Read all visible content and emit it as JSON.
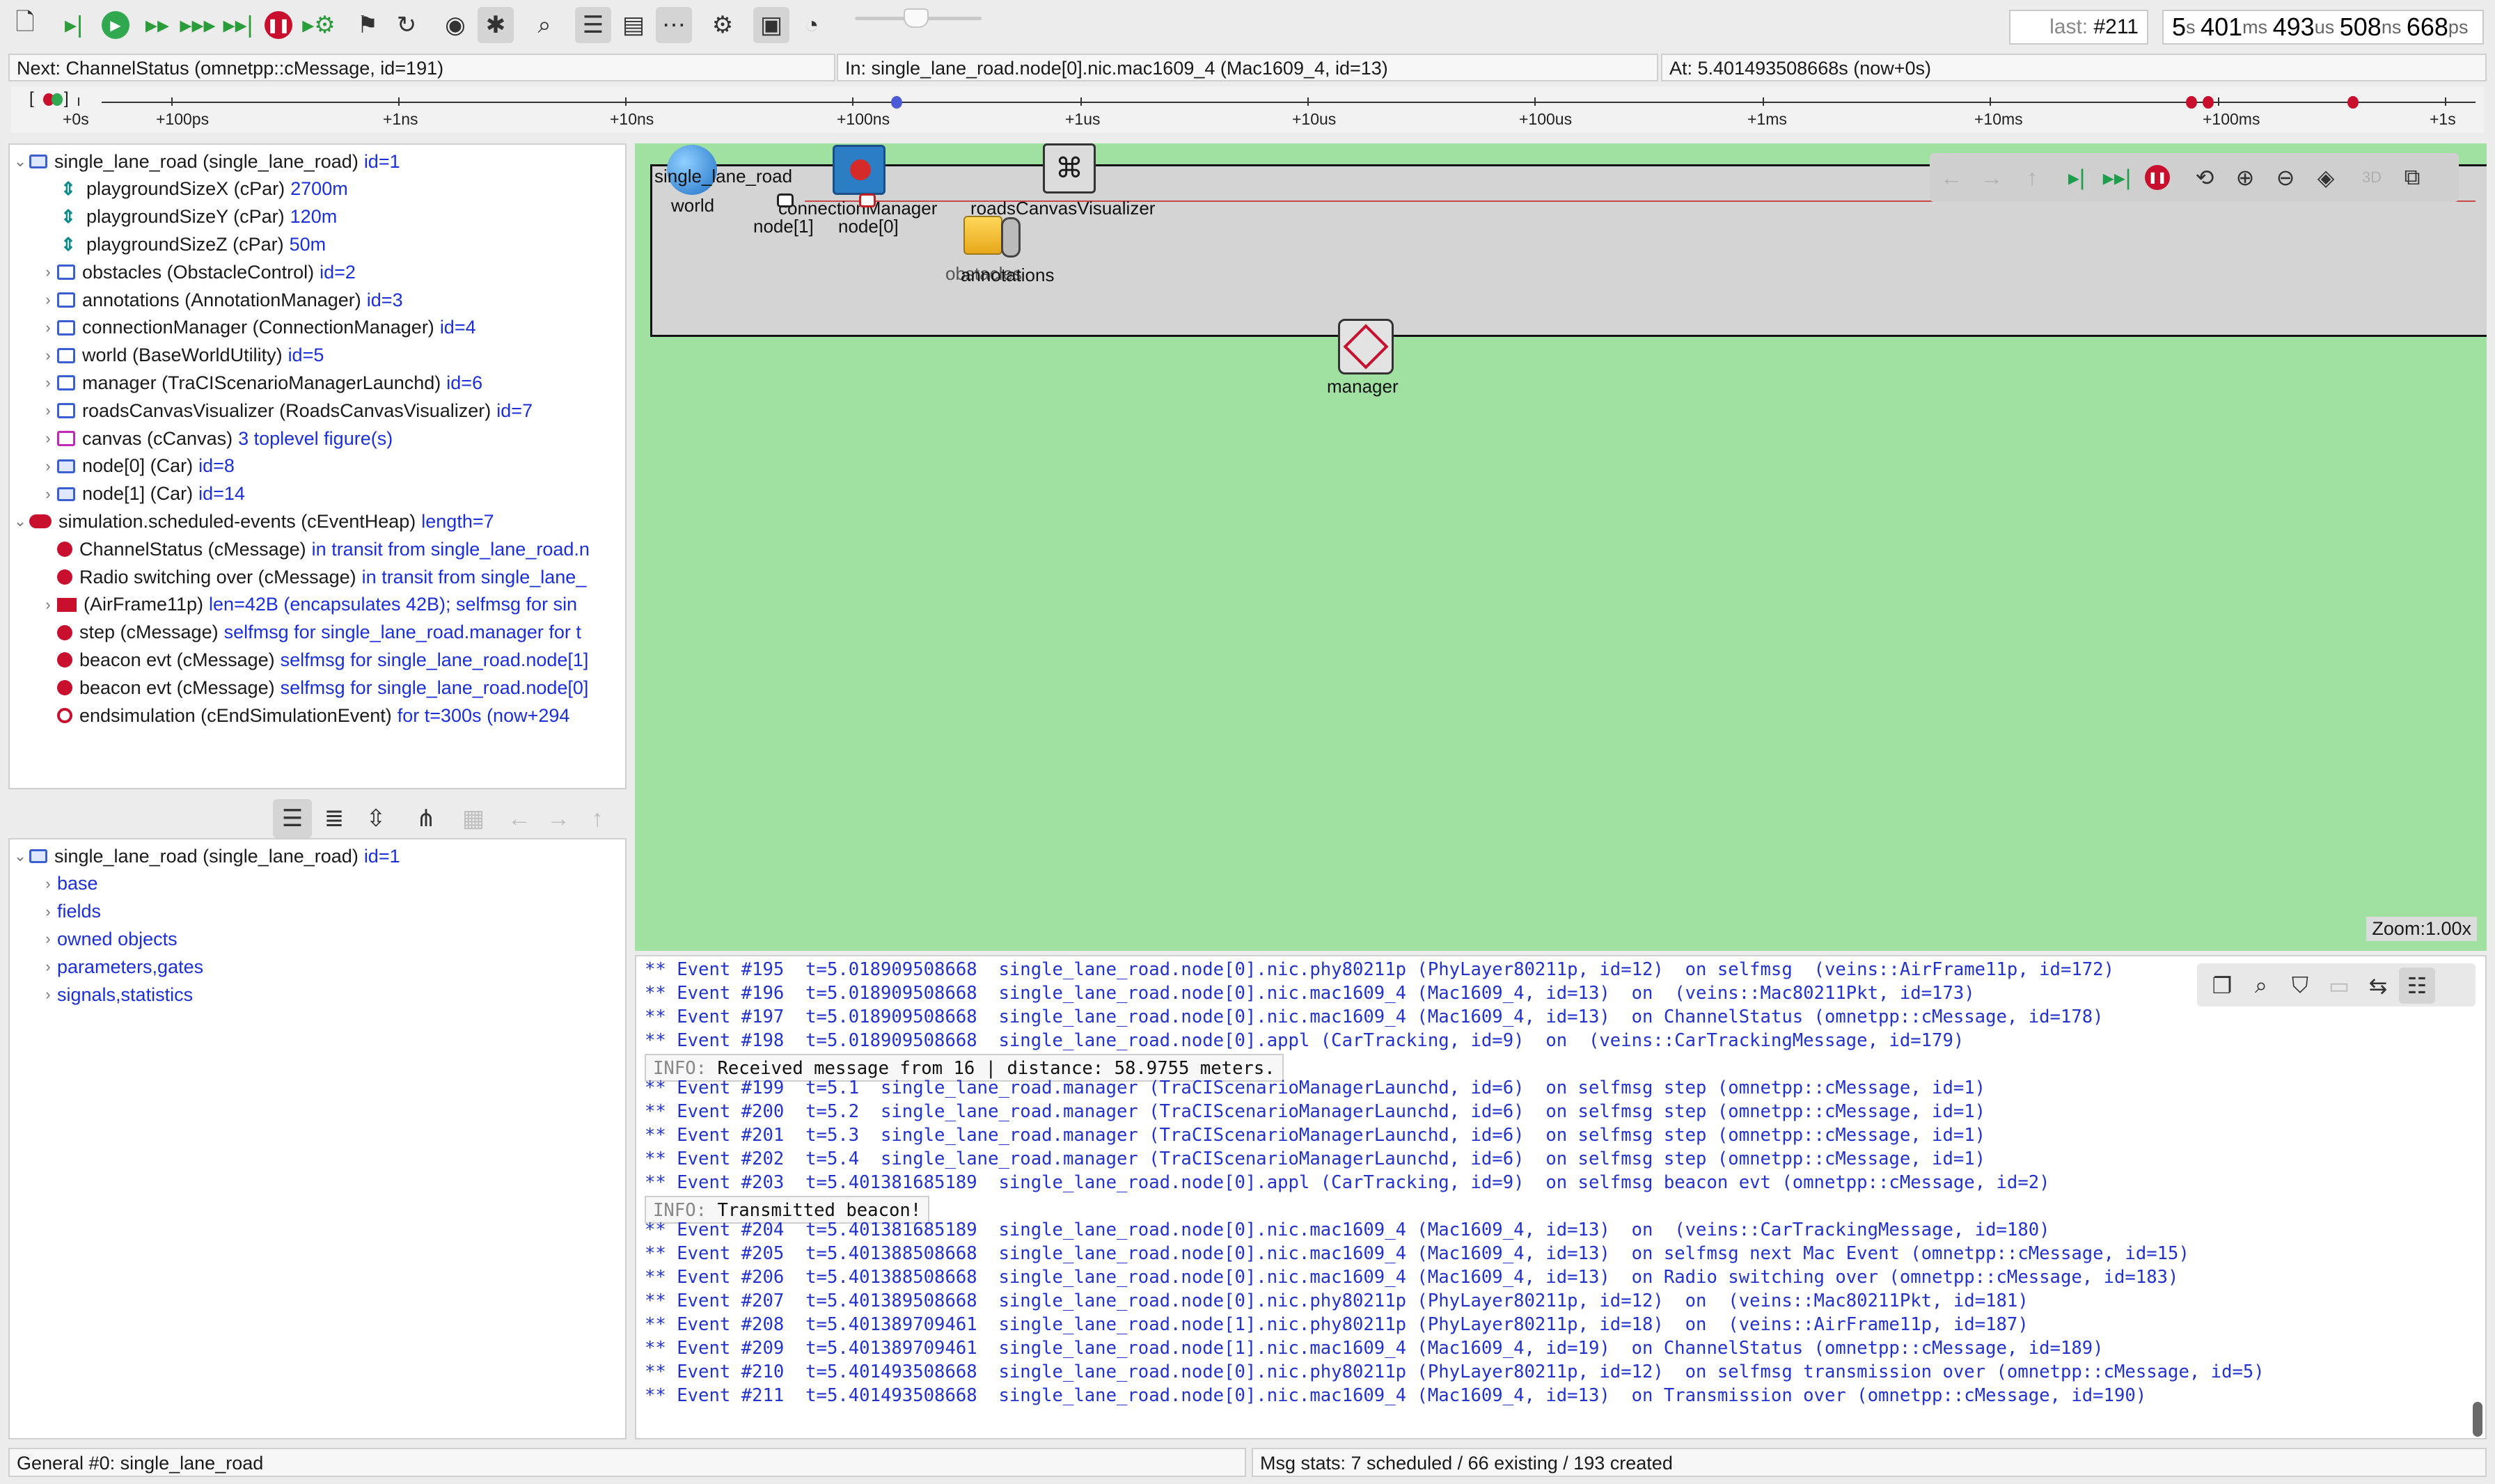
{
  "toolbar": {
    "buttons": [
      "new-file-icon",
      "step-icon",
      "run-icon",
      "fast-run-icon",
      "express-run-icon",
      "run-until-icon",
      "stop-icon",
      "debug-next-icon",
      "finish-flag-icon",
      "rebuild-icon",
      "record-icon",
      "debug-icon",
      "find-icon",
      "tree-view-icon",
      "split-view-icon",
      "timeline-toggle-icon",
      "settings-icon",
      "video-icon",
      "speed-gauge-icon"
    ],
    "last_event_label": "last:",
    "last_event_value": "#211",
    "simtime": {
      "s": "5",
      "ms": "401",
      "us": "493",
      "us2": "508",
      "ps": "668"
    }
  },
  "info": {
    "next": "Next: ChannelStatus (omnetpp::cMessage, id=191)",
    "in": "In: single_lane_road.node[0].nic.mac1609_4 (Mac1609_4, id=13)",
    "at": "At: 5.401493508668s (now+0s)"
  },
  "timeline": {
    "bracket": "[",
    "bracket_end": "]",
    "ticks": [
      "+0s",
      "+100ps",
      "+1ns",
      "+10ns",
      "+100ns",
      "+1us",
      "+10us",
      "+100us",
      "+1ms",
      "+10ms",
      "+100ms",
      "+1s"
    ]
  },
  "objtree": {
    "root": {
      "name": "single_lane_road (single_lane_road)",
      "detail": "id=1"
    },
    "children": [
      {
        "icon": "param",
        "name": "playgroundSizeX (cPar)",
        "detail": "2700m"
      },
      {
        "icon": "param",
        "name": "playgroundSizeY (cPar)",
        "detail": "120m"
      },
      {
        "icon": "param",
        "name": "playgroundSizeZ (cPar)",
        "detail": "50m"
      },
      {
        "icon": "module",
        "name": "obstacles (ObstacleControl)",
        "detail": "id=2"
      },
      {
        "icon": "module",
        "name": "annotations (AnnotationManager)",
        "detail": "id=3"
      },
      {
        "icon": "module",
        "name": "connectionManager (ConnectionManager)",
        "detail": "id=4"
      },
      {
        "icon": "module",
        "name": "world (BaseWorldUtility)",
        "detail": "id=5"
      },
      {
        "icon": "module",
        "name": "manager (TraCIScenarioManagerLaunchd)",
        "detail": "id=6"
      },
      {
        "icon": "module",
        "name": "roadsCanvasVisualizer (RoadsCanvasVisualizer)",
        "detail": "id=7"
      },
      {
        "icon": "canvas",
        "name": "canvas (cCanvas)",
        "detail": "3 toplevel figure(s)"
      },
      {
        "icon": "compound",
        "name": "node[0] (Car)",
        "detail": "id=8"
      },
      {
        "icon": "compound",
        "name": "node[1] (Car)",
        "detail": "id=14"
      }
    ],
    "heap": {
      "name": "simulation.scheduled-events (cEventHeap)",
      "detail": "length=7"
    },
    "events": [
      {
        "icon": "msg",
        "name": "ChannelStatus (cMessage)",
        "detail": "in transit from single_lane_road.n"
      },
      {
        "icon": "msg",
        "name": "Radio switching over (cMessage)",
        "detail": "in transit from single_lane_"
      },
      {
        "icon": "packet",
        "name": "(AirFrame11p)",
        "detail": "len=42B (encapsulates 42B); selfmsg for sin"
      },
      {
        "icon": "msg",
        "name": "step (cMessage)",
        "detail": "selfmsg for single_lane_road.manager for t"
      },
      {
        "icon": "msg",
        "name": "beacon evt (cMessage)",
        "detail": "selfmsg for single_lane_road.node[1]"
      },
      {
        "icon": "msg",
        "name": "beacon evt (cMessage)",
        "detail": "selfmsg for single_lane_road.node[0]"
      },
      {
        "icon": "endsim",
        "name": "endsimulation (cEndSimulationEvent)",
        "detail": "for t=300s (now+294"
      }
    ]
  },
  "proptree": {
    "root": {
      "name": "single_lane_road (single_lane_road)",
      "detail": "id=1"
    },
    "groups": [
      "base",
      "fields",
      "owned objects",
      "parameters,gates",
      "signals,statistics"
    ]
  },
  "network": {
    "title": "single_lane_road",
    "modules": [
      {
        "label": "world",
        "icon": "globe-icon"
      },
      {
        "label": "connectionManager",
        "icon": "network-hub-icon"
      },
      {
        "label": "roadsCanvasVisualizer",
        "icon": "puzzle-icon"
      },
      {
        "label": "obstacles",
        "icon": "obstacle-icon"
      },
      {
        "label": "annotations",
        "icon": "annotation-icon"
      },
      {
        "label": "manager",
        "icon": "manager-icon"
      },
      {
        "label": "node[1]",
        "icon": "car-icon"
      },
      {
        "label": "node[0]",
        "icon": "car-icon"
      }
    ],
    "zoom": "Zoom:1.00x"
  },
  "log": [
    {
      "type": "event",
      "text": "** Event #195  t=5.018909508668  single_lane_road.node[0].nic.phy80211p (PhyLayer80211p, id=12)  on selfmsg  (veins::AirFrame11p, id=172)"
    },
    {
      "type": "event",
      "text": "** Event #196  t=5.018909508668  single_lane_road.node[0].nic.mac1609_4 (Mac1609_4, id=13)  on  (veins::Mac80211Pkt, id=173)"
    },
    {
      "type": "event",
      "text": "** Event #197  t=5.018909508668  single_lane_road.node[0].nic.mac1609_4 (Mac1609_4, id=13)  on ChannelStatus (omnetpp::cMessage, id=178)"
    },
    {
      "type": "event",
      "text": "** Event #198  t=5.018909508668  single_lane_road.node[0].appl (CarTracking, id=9)  on  (veins::CarTrackingMessage, id=179)"
    },
    {
      "type": "info",
      "level": "INFO:",
      "text": " Received message from 16 | distance: 58.9755 meters."
    },
    {
      "type": "event",
      "text": "** Event #199  t=5.1  single_lane_road.manager (TraCIScenarioManagerLaunchd, id=6)  on selfmsg step (omnetpp::cMessage, id=1)"
    },
    {
      "type": "event",
      "text": "** Event #200  t=5.2  single_lane_road.manager (TraCIScenarioManagerLaunchd, id=6)  on selfmsg step (omnetpp::cMessage, id=1)"
    },
    {
      "type": "event",
      "text": "** Event #201  t=5.3  single_lane_road.manager (TraCIScenarioManagerLaunchd, id=6)  on selfmsg step (omnetpp::cMessage, id=1)"
    },
    {
      "type": "event",
      "text": "** Event #202  t=5.4  single_lane_road.manager (TraCIScenarioManagerLaunchd, id=6)  on selfmsg step (omnetpp::cMessage, id=1)"
    },
    {
      "type": "event",
      "text": "** Event #203  t=5.401381685189  single_lane_road.node[0].appl (CarTracking, id=9)  on selfmsg beacon evt (omnetpp::cMessage, id=2)"
    },
    {
      "type": "info",
      "level": "INFO:",
      "text": " Transmitted beacon!"
    },
    {
      "type": "event",
      "text": "** Event #204  t=5.401381685189  single_lane_road.node[0].nic.mac1609_4 (Mac1609_4, id=13)  on  (veins::CarTrackingMessage, id=180)"
    },
    {
      "type": "event",
      "text": "** Event #205  t=5.401388508668  single_lane_road.node[0].nic.mac1609_4 (Mac1609_4, id=13)  on selfmsg next Mac Event (omnetpp::cMessage, id=15)"
    },
    {
      "type": "event",
      "text": "** Event #206  t=5.401388508668  single_lane_road.node[0].nic.mac1609_4 (Mac1609_4, id=13)  on Radio switching over (omnetpp::cMessage, id=183)"
    },
    {
      "type": "event",
      "text": "** Event #207  t=5.401389508668  single_lane_road.node[0].nic.phy80211p (PhyLayer80211p, id=12)  on  (veins::Mac80211Pkt, id=181)"
    },
    {
      "type": "event",
      "text": "** Event #208  t=5.401389709461  single_lane_road.node[1].nic.phy80211p (PhyLayer80211p, id=18)  on  (veins::AirFrame11p, id=187)"
    },
    {
      "type": "event",
      "text": "** Event #209  t=5.401389709461  single_lane_road.node[1].nic.mac1609_4 (Mac1609_4, id=19)  on ChannelStatus (omnetpp::cMessage, id=189)"
    },
    {
      "type": "event",
      "text": "** Event #210  t=5.401493508668  single_lane_road.node[0].nic.phy80211p (PhyLayer80211p, id=12)  on selfmsg transmission over (omnetpp::cMessage, id=5)"
    },
    {
      "type": "event",
      "text": "** Event #211  t=5.401493508668  single_lane_road.node[0].nic.mac1609_4 (Mac1609_4, id=13)  on Transmission over (omnetpp::cMessage, id=190)"
    }
  ],
  "status": {
    "left": "General #0: single_lane_road",
    "right": "Msg stats: 7 scheduled / 66 existing / 193 created"
  },
  "colors": {
    "detail": "#1a2fd8",
    "event_msg": "#c8102e",
    "canvas_bg": "#a0e0a0",
    "log_event": "#2233cc"
  }
}
